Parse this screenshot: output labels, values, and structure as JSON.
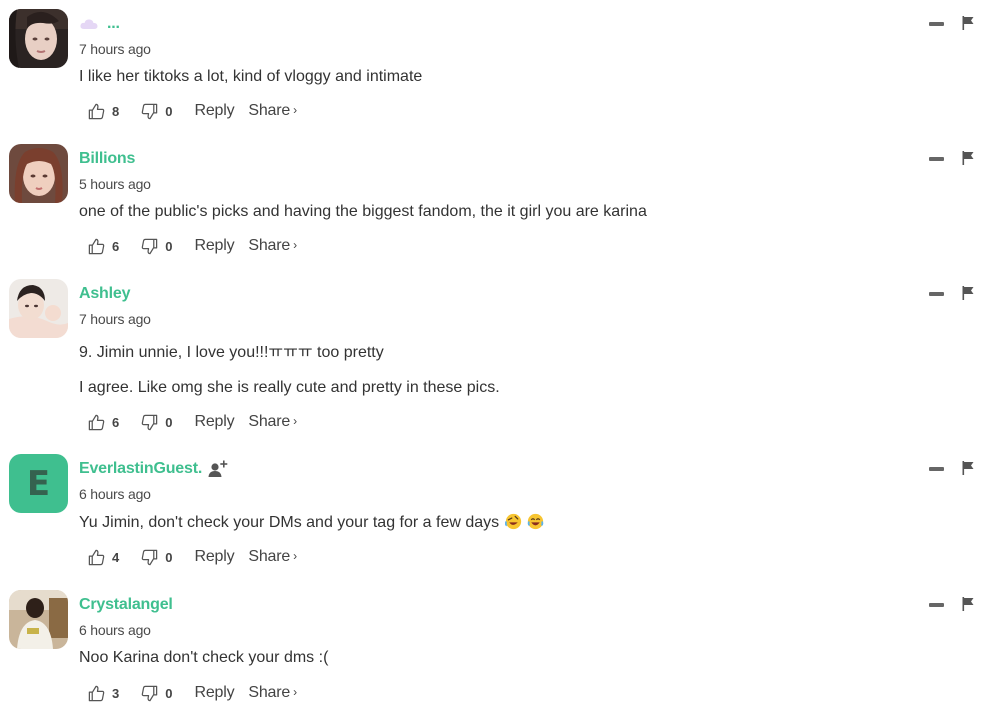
{
  "comments": [
    {
      "username": "...",
      "timestamp": "7 hours ago",
      "text": [
        "I like her tiktoks a lot, kind of vloggy and intimate"
      ],
      "likes": "8",
      "dislikes": "0",
      "reply_label": "Reply",
      "share_label": "Share",
      "share_chevron": "›"
    },
    {
      "username": "Billions",
      "timestamp": "5 hours ago",
      "text": [
        "one of the public's picks and having the biggest fandom, the it girl you are karina"
      ],
      "likes": "6",
      "dislikes": "0",
      "reply_label": "Reply",
      "share_label": "Share",
      "share_chevron": "›"
    },
    {
      "username": "Ashley",
      "timestamp": "7 hours ago",
      "text": [
        "9. Jimin unnie, I love you!!!ㅠㅠㅠ too pretty",
        "I agree. Like omg she is really cute and pretty in these pics."
      ],
      "likes": "6",
      "dislikes": "0",
      "reply_label": "Reply",
      "share_label": "Share",
      "share_chevron": "›"
    },
    {
      "username": "EverlastinGuest.",
      "avatar_letter": "E",
      "timestamp": "6 hours ago",
      "text": [
        "Yu Jimin, don't check your DMs and your tag for a few days"
      ],
      "emojis": [
        "rolling-on-floor-laughing-emoji",
        "tears-of-joy-emoji"
      ],
      "likes": "4",
      "dislikes": "0",
      "reply_label": "Reply",
      "share_label": "Share",
      "share_chevron": "›"
    },
    {
      "username": "Crystalangel",
      "timestamp": "6 hours ago",
      "text": [
        "Noo Karina don't check your dms :("
      ],
      "likes": "3",
      "dislikes": "0",
      "reply_label": "Reply",
      "share_label": "Share",
      "share_chevron": "›"
    }
  ],
  "colors": {
    "accent": "#3fbf8f",
    "text": "#333333",
    "muted": "#4a4a4a",
    "icon": "#666666"
  },
  "icons": {
    "like": "thumbs-up-icon",
    "dislike": "thumbs-down-icon",
    "collapse": "minus-icon",
    "report": "flag-icon",
    "follow": "add-user-icon"
  }
}
